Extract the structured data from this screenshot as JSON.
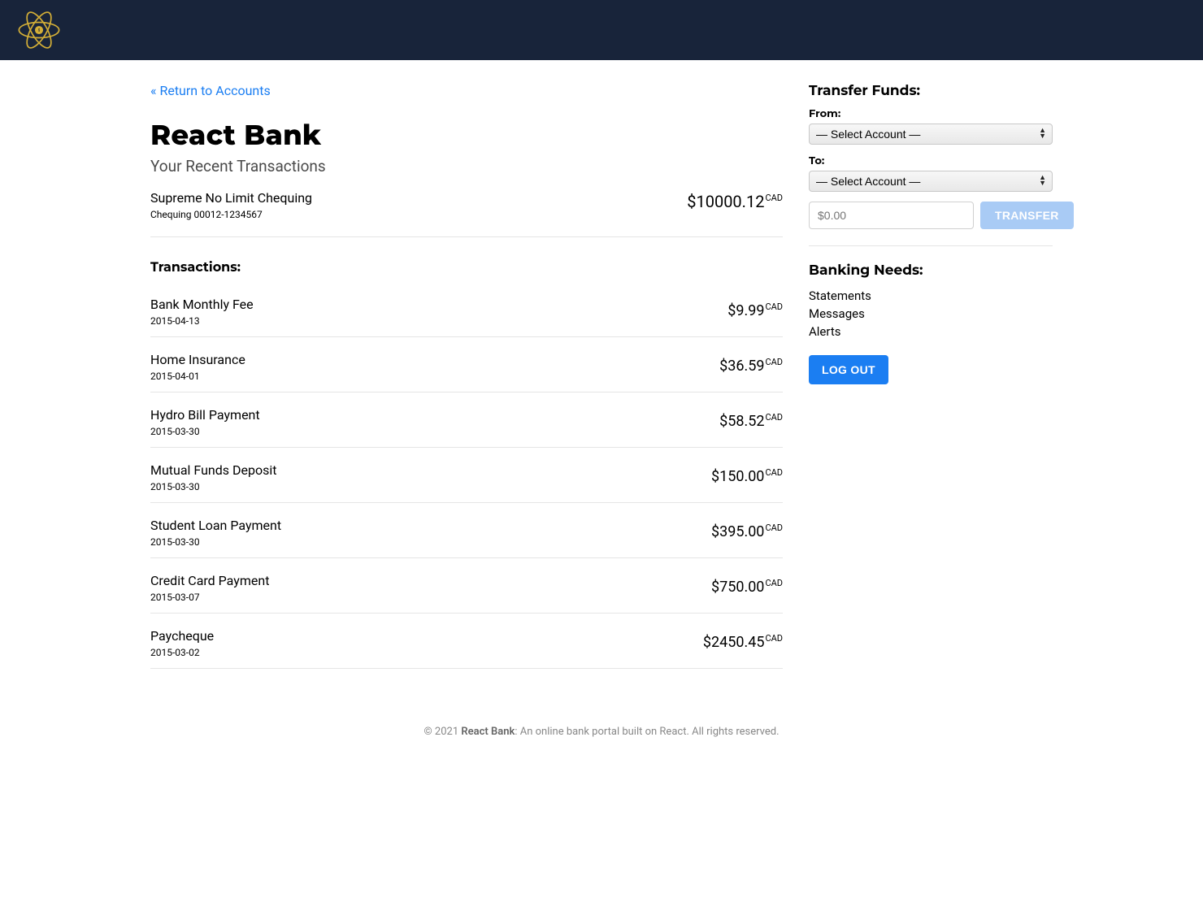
{
  "nav": {
    "return_link": "« Return to Accounts"
  },
  "bank": {
    "title": "React Bank",
    "subtitle": "Your Recent Transactions"
  },
  "account": {
    "name": "Supreme No Limit Chequing",
    "type_line": "Chequing 00012-1234567",
    "balance_display": "$10000.12",
    "balance_currency": "CAD"
  },
  "transactions_header": "Transactions:",
  "transactions": [
    {
      "desc": "Bank Monthly Fee",
      "date": "2015-04-13",
      "amount": "$9.99",
      "currency": "CAD"
    },
    {
      "desc": "Home Insurance",
      "date": "2015-04-01",
      "amount": "$36.59",
      "currency": "CAD"
    },
    {
      "desc": "Hydro Bill Payment",
      "date": "2015-03-30",
      "amount": "$58.52",
      "currency": "CAD"
    },
    {
      "desc": "Mutual Funds Deposit",
      "date": "2015-03-30",
      "amount": "$150.00",
      "currency": "CAD"
    },
    {
      "desc": "Student Loan Payment",
      "date": "2015-03-30",
      "amount": "$395.00",
      "currency": "CAD"
    },
    {
      "desc": "Credit Card Payment",
      "date": "2015-03-07",
      "amount": "$750.00",
      "currency": "CAD"
    },
    {
      "desc": "Paycheque",
      "date": "2015-03-02",
      "amount": "$2450.45",
      "currency": "CAD"
    }
  ],
  "transfer": {
    "heading": "Transfer Funds:",
    "from_label": "From:",
    "to_label": "To:",
    "select_placeholder": "— Select Account —",
    "amount_placeholder": "$0.00",
    "button": "TRANSFER"
  },
  "needs": {
    "heading": "Banking Needs:",
    "items": [
      "Statements",
      "Messages",
      "Alerts"
    ]
  },
  "logout_label": "LOG OUT",
  "footer": {
    "prefix": "© 2021 ",
    "brand": "React Bank",
    "suffix": ": An online bank portal built on React. All rights reserved."
  }
}
